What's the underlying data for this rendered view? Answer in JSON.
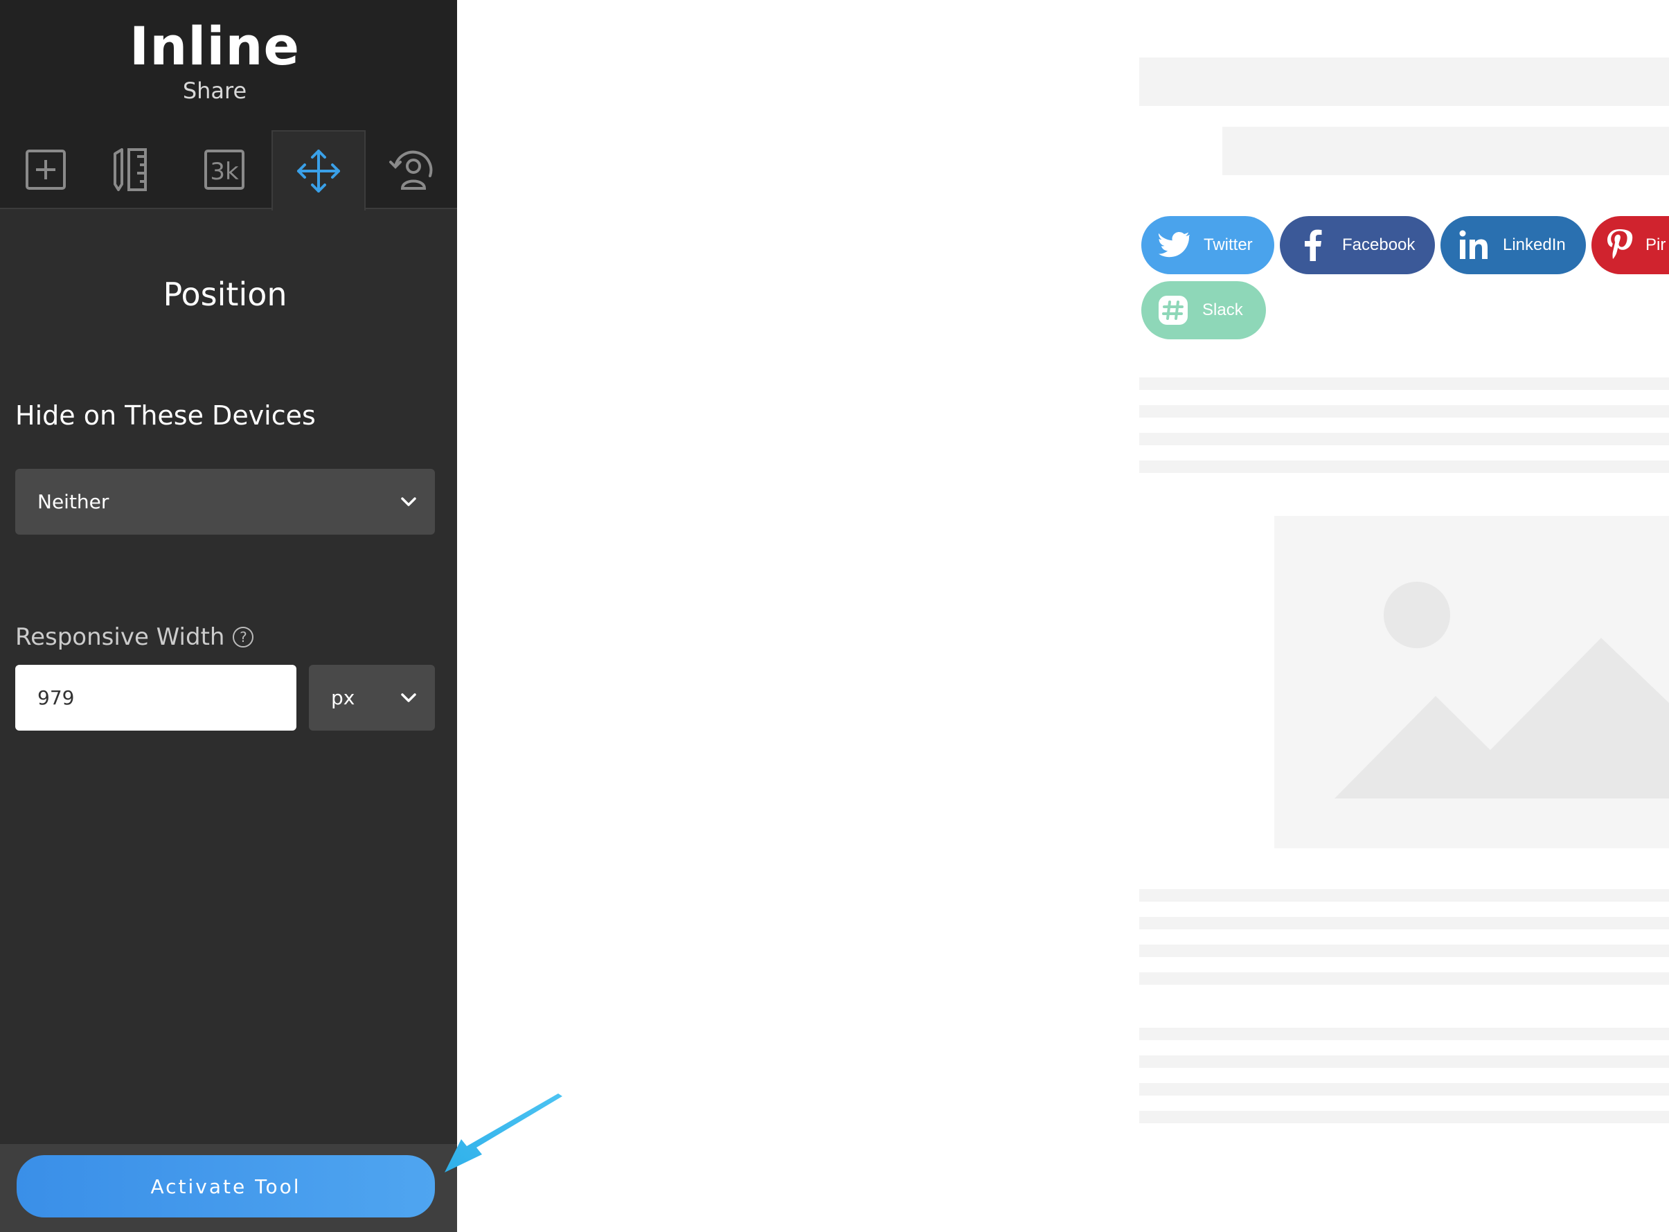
{
  "sidebar": {
    "title": "Inline",
    "subtitle": "Share",
    "tabs": [
      {
        "name": "add-icon",
        "active": false
      },
      {
        "name": "ruler-pencil-icon",
        "active": false
      },
      {
        "name": "count-3k-icon",
        "label": "3k",
        "active": false
      },
      {
        "name": "move-arrows-icon",
        "active": true
      },
      {
        "name": "user-refresh-icon",
        "active": false
      }
    ],
    "section_title": "Position",
    "hide_devices": {
      "label": "Hide on These Devices",
      "value": "Neither"
    },
    "responsive_width": {
      "label": "Responsive Width",
      "help": "?",
      "value": "979",
      "unit": "px"
    },
    "activate_label": "Activate Tool"
  },
  "preview": {
    "share_buttons": [
      {
        "label": "Twitter",
        "color": "#4aa3ec",
        "icon": "twitter-bird-icon"
      },
      {
        "label": "Facebook",
        "color": "#3b5998",
        "icon": "facebook-f-icon"
      },
      {
        "label": "LinkedIn",
        "color": "#2a70b0",
        "icon": "linkedin-in-icon"
      },
      {
        "label": "Pinterest",
        "visible_label": "Pir",
        "color": "#d0232e",
        "icon": "pinterest-p-icon"
      },
      {
        "label": "Slack",
        "color": "#8ed7b8",
        "icon": "slack-hash-icon"
      }
    ],
    "accent_color": "#3a8fe8"
  }
}
